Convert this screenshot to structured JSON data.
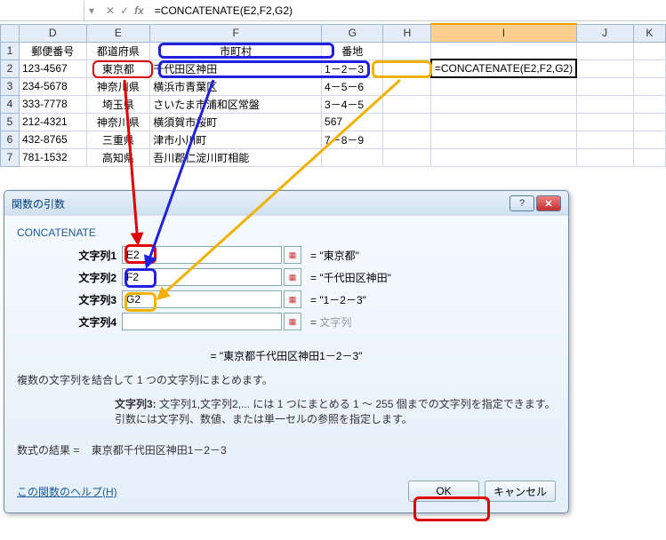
{
  "ref": {
    "formula": "=CONCATENATE(E2,F2,G2)",
    "name_box": ""
  },
  "cols": [
    "D",
    "E",
    "F",
    "G",
    "H",
    "I",
    "J",
    "K"
  ],
  "headers": {
    "D": "郵便番号",
    "E": "都道府県",
    "F": "市町村",
    "G": "番地"
  },
  "rows": [
    {
      "n": "1"
    },
    {
      "n": "2",
      "D": "123-4567",
      "E": "東京都",
      "F": "千代田区神田",
      "G": "1－2－3",
      "I": "=CONCATENATE(E2,F2,G2)"
    },
    {
      "n": "3",
      "D": "234-5678",
      "E": "神奈川県",
      "F": "横浜市青葉区",
      "G": "4－5－6"
    },
    {
      "n": "4",
      "D": "333-7778",
      "E": "埼玉県",
      "F": "さいたま市浦和区常盤",
      "G": "3－4－5"
    },
    {
      "n": "5",
      "D": "212-4321",
      "E": "神奈川県",
      "F": "横須賀市桜町",
      "G": "567"
    },
    {
      "n": "6",
      "D": "432-8765",
      "E": "三重県",
      "F": "津市小川町",
      "G": "7－8－9"
    },
    {
      "n": "7",
      "D": "781-1532",
      "E": "高知県",
      "F": "吾川郡仁淀川町相能",
      "G": ""
    }
  ],
  "dialog": {
    "title": "関数の引数",
    "fn": "CONCATENATE",
    "args": [
      {
        "label": "文字列1",
        "value": "E2",
        "result": "= \"東京都\""
      },
      {
        "label": "文字列2",
        "value": "F2",
        "result": "= \"千代田区神田\""
      },
      {
        "label": "文字列3",
        "value": "G2",
        "result": "= \"1－2－3\""
      },
      {
        "label": "文字列4",
        "value": "",
        "result": "= ",
        "placeholder": "文字列"
      }
    ],
    "overall_result": "= \"東京都千代田区神田1－2－3\"",
    "desc": "複数の文字列を結合して 1 つの文字列にまとめます。",
    "arg_desc_label": "文字列3:",
    "arg_desc": "文字列1,文字列2,... には 1 つにまとめる 1 ～ 255 個までの文字列を指定できます。引数には文字列、数値、または単一セルの参照を指定します。",
    "formula_result_label": "数式の結果 =",
    "formula_result": "東京都千代田区神田1－2－3",
    "help": "この関数のヘルプ(H)",
    "ok": "OK",
    "cancel": "キャンセル"
  }
}
